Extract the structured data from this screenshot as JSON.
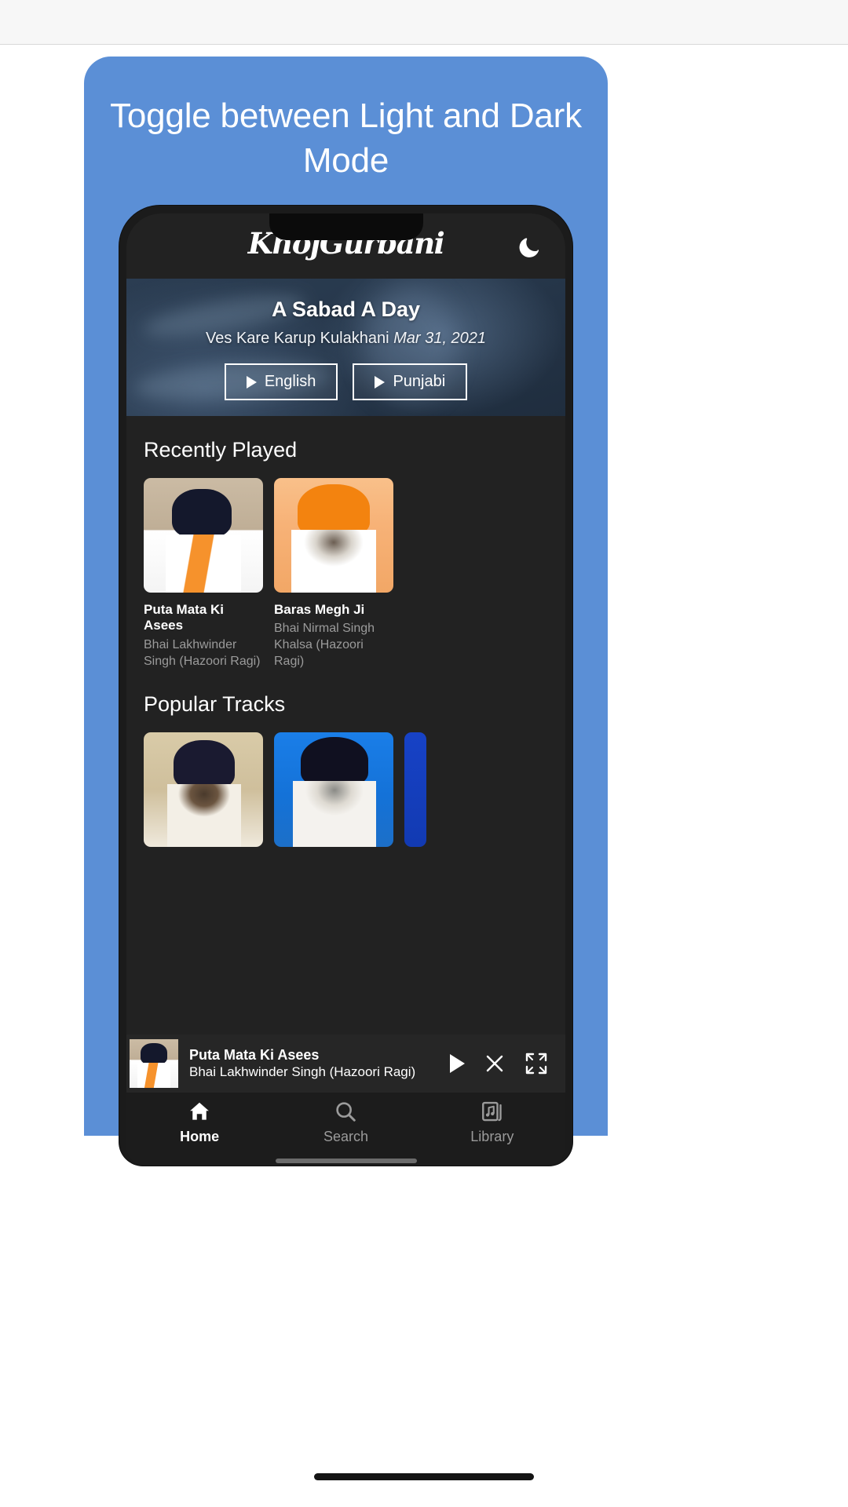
{
  "promo": {
    "headline": "Toggle between Light and Dark Mode",
    "background_color": "#5b8fd6"
  },
  "app": {
    "logo_text": "KhojGurbani",
    "theme_toggle_icon": "moon-icon",
    "background_color": "#222222"
  },
  "banner": {
    "title": "A Sabad A Day",
    "subtitle": "Ves Kare Karup Kulakhani",
    "date": "Mar 31, 2021",
    "buttons": [
      {
        "label": "English",
        "icon": "play-icon"
      },
      {
        "label": "Punjabi",
        "icon": "play-icon"
      }
    ]
  },
  "sections": [
    {
      "title": "Recently Played",
      "cards": [
        {
          "title": "Puta Mata Ki Asees",
          "artist": "Bhai Lakhwinder Singh (Hazoori Ragi)"
        },
        {
          "title": "Baras Megh Ji",
          "artist": "Bhai Nirmal Singh Khalsa (Hazoori Ragi)"
        }
      ]
    },
    {
      "title": "Popular Tracks",
      "cards": [
        {
          "title": "",
          "artist": ""
        },
        {
          "title": "",
          "artist": ""
        },
        {
          "title": "",
          "artist": ""
        }
      ]
    }
  ],
  "mini_player": {
    "title": "Puta Mata Ki Asees",
    "artist": "Bhai Lakhwinder Singh (Hazoori Ragi)",
    "controls": [
      {
        "name": "play-icon"
      },
      {
        "name": "close-icon"
      },
      {
        "name": "expand-icon"
      }
    ]
  },
  "bottom_nav": [
    {
      "label": "Home",
      "icon": "home-icon",
      "active": true
    },
    {
      "label": "Search",
      "icon": "search-icon",
      "active": false
    },
    {
      "label": "Library",
      "icon": "library-icon",
      "active": false
    }
  ]
}
